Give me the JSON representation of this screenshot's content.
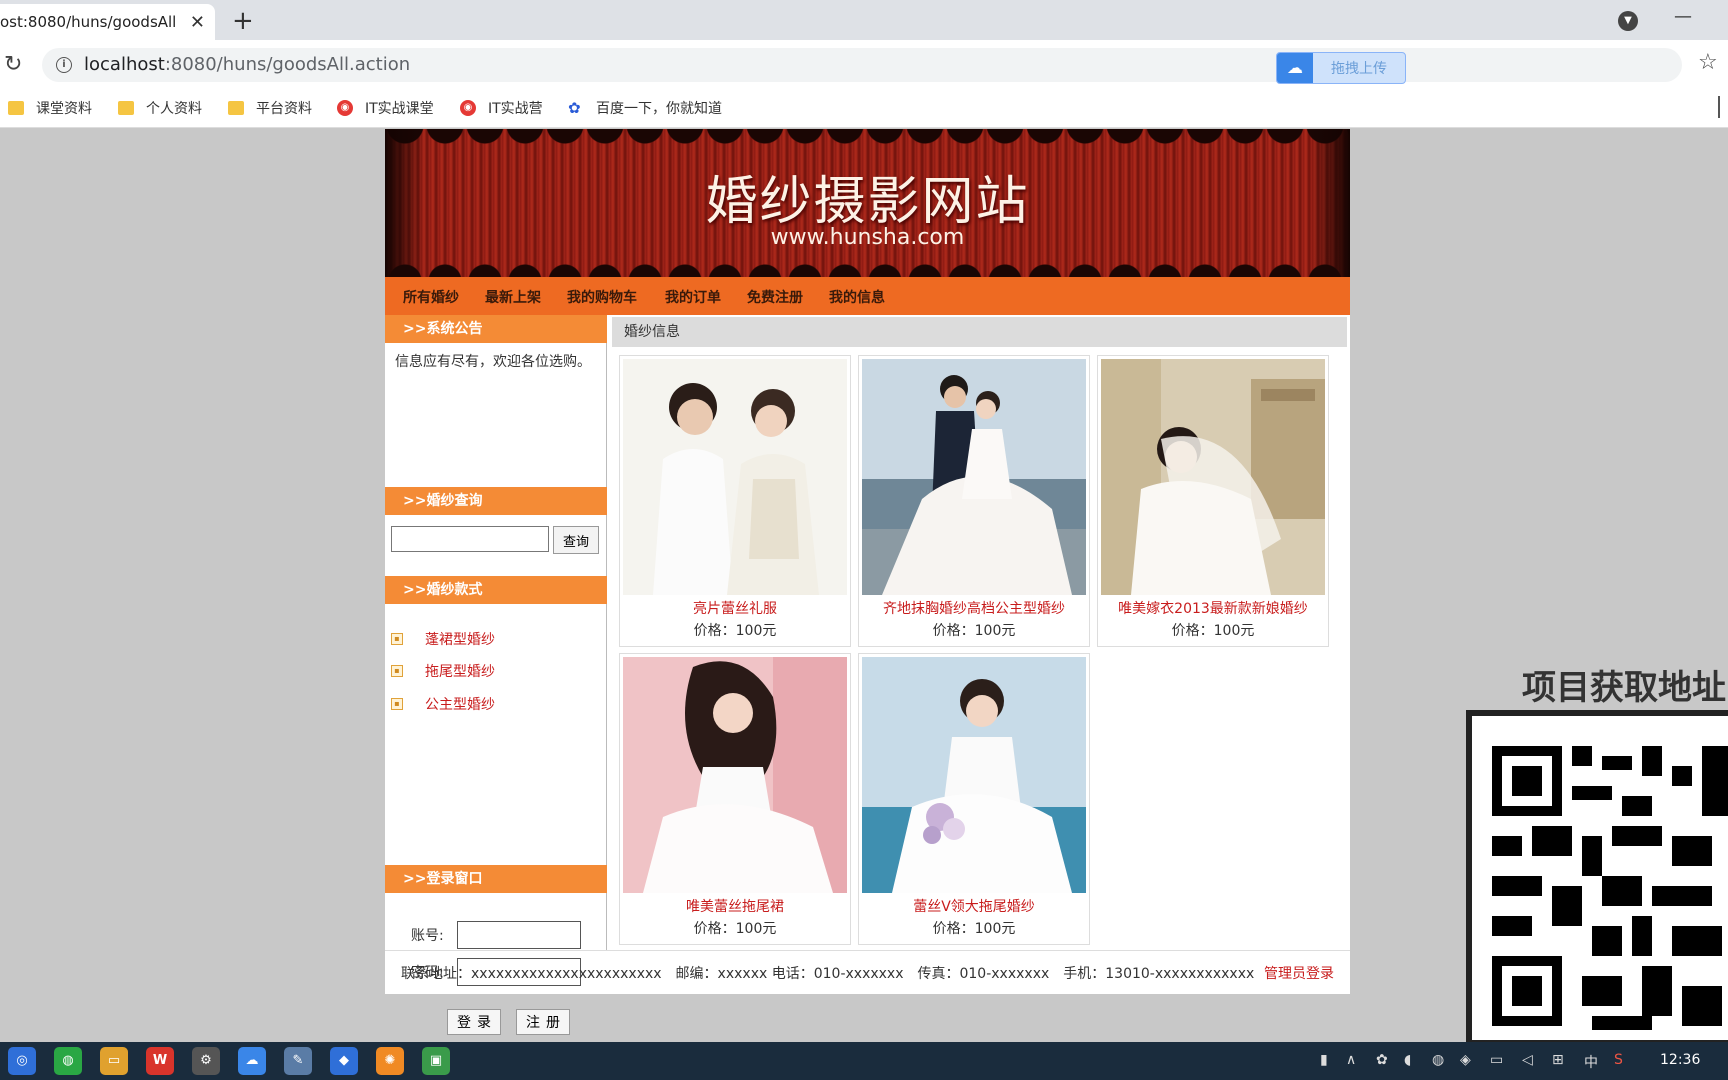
{
  "browser": {
    "tab_title": "ost:8080/huns/goodsAll",
    "url_host": "localhost",
    "url_rest": ":8080/huns/goodsAll.action",
    "upload_label": "拖拽上传",
    "bookmarks": [
      {
        "label": "课堂资料",
        "icon": "folder-icon"
      },
      {
        "label": "个人资料",
        "icon": "folder-icon"
      },
      {
        "label": "平台资料",
        "icon": "folder-icon"
      },
      {
        "label": "IT实战课堂",
        "icon": "site-icon"
      },
      {
        "label": "IT实战营",
        "icon": "site-icon"
      },
      {
        "label": "百度一下，你就知道",
        "icon": "paw-icon"
      }
    ]
  },
  "site": {
    "banner_title": "婚纱摄影网站",
    "banner_url": "www.hunsha.com",
    "nav": [
      "所有婚纱",
      "最新上架",
      "我的购物车",
      "我的订单",
      "免费注册",
      "我的信息"
    ],
    "sidebar": {
      "notice_head": ">>系统公告",
      "notice_text": "信息应有尽有，欢迎各位选购。",
      "search_head": ">>婚纱查询",
      "search_button": "查询",
      "styles_head": ">>婚纱款式",
      "styles": [
        "蓬裙型婚纱",
        "拖尾型婚纱",
        "公主型婚纱"
      ],
      "login_head": ">>登录窗口",
      "account_label": "账号:",
      "password_label": "密码:",
      "login_button": "登录",
      "register_button": "注册"
    },
    "content_head": "婚纱信息",
    "products": [
      {
        "name": "亮片蕾丝礼服",
        "price": "价格：100元"
      },
      {
        "name": "齐地抹胸婚纱高档公主型婚纱",
        "price": "价格：100元"
      },
      {
        "name": "唯美嫁衣2013最新款新娘婚纱",
        "price": "价格：100元"
      },
      {
        "name": "唯美蕾丝拖尾裙",
        "price": "价格：100元"
      },
      {
        "name": "蕾丝V领大拖尾婚纱",
        "price": "价格：100元"
      }
    ],
    "footer": "联系地址：xxxxxxxxxxxxxxxxxxxxxxx　邮编：xxxxxx 电话：010-xxxxxxx　传真：010-xxxxxxx　手机：13010-xxxxxxxxxxxx",
    "admin_link": "管理员登录"
  },
  "overlay": {
    "promo_title": "项目获取地址"
  },
  "taskbar": {
    "clock": "12:36",
    "tray_lang": "中"
  },
  "colors": {
    "nav_orange": "#ee6a22",
    "side_head_orange": "#f48b36",
    "link_red": "#c81d1d"
  }
}
